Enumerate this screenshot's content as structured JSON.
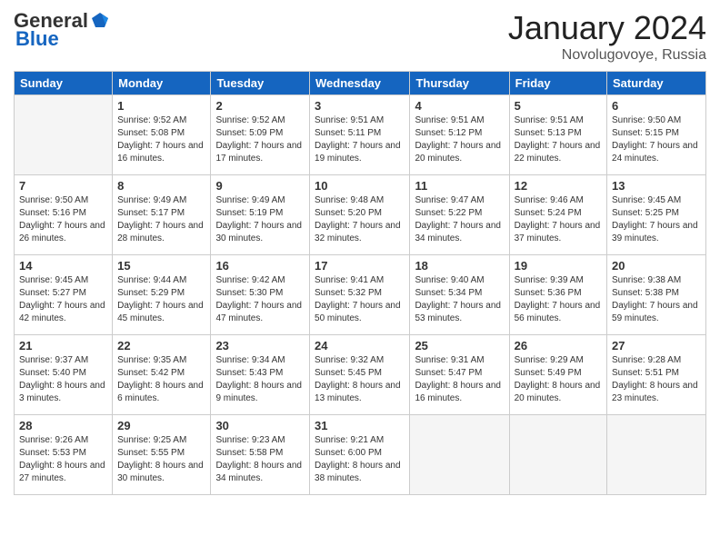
{
  "header": {
    "logo_general": "General",
    "logo_blue": "Blue",
    "month": "January 2024",
    "location": "Novolugovoye, Russia"
  },
  "days_of_week": [
    "Sunday",
    "Monday",
    "Tuesday",
    "Wednesday",
    "Thursday",
    "Friday",
    "Saturday"
  ],
  "weeks": [
    [
      {
        "day": "",
        "empty": true
      },
      {
        "day": "1",
        "sunrise": "Sunrise: 9:52 AM",
        "sunset": "Sunset: 5:08 PM",
        "daylight": "Daylight: 7 hours and 16 minutes."
      },
      {
        "day": "2",
        "sunrise": "Sunrise: 9:52 AM",
        "sunset": "Sunset: 5:09 PM",
        "daylight": "Daylight: 7 hours and 17 minutes."
      },
      {
        "day": "3",
        "sunrise": "Sunrise: 9:51 AM",
        "sunset": "Sunset: 5:11 PM",
        "daylight": "Daylight: 7 hours and 19 minutes."
      },
      {
        "day": "4",
        "sunrise": "Sunrise: 9:51 AM",
        "sunset": "Sunset: 5:12 PM",
        "daylight": "Daylight: 7 hours and 20 minutes."
      },
      {
        "day": "5",
        "sunrise": "Sunrise: 9:51 AM",
        "sunset": "Sunset: 5:13 PM",
        "daylight": "Daylight: 7 hours and 22 minutes."
      },
      {
        "day": "6",
        "sunrise": "Sunrise: 9:50 AM",
        "sunset": "Sunset: 5:15 PM",
        "daylight": "Daylight: 7 hours and 24 minutes."
      }
    ],
    [
      {
        "day": "7",
        "sunrise": "Sunrise: 9:50 AM",
        "sunset": "Sunset: 5:16 PM",
        "daylight": "Daylight: 7 hours and 26 minutes."
      },
      {
        "day": "8",
        "sunrise": "Sunrise: 9:49 AM",
        "sunset": "Sunset: 5:17 PM",
        "daylight": "Daylight: 7 hours and 28 minutes."
      },
      {
        "day": "9",
        "sunrise": "Sunrise: 9:49 AM",
        "sunset": "Sunset: 5:19 PM",
        "daylight": "Daylight: 7 hours and 30 minutes."
      },
      {
        "day": "10",
        "sunrise": "Sunrise: 9:48 AM",
        "sunset": "Sunset: 5:20 PM",
        "daylight": "Daylight: 7 hours and 32 minutes."
      },
      {
        "day": "11",
        "sunrise": "Sunrise: 9:47 AM",
        "sunset": "Sunset: 5:22 PM",
        "daylight": "Daylight: 7 hours and 34 minutes."
      },
      {
        "day": "12",
        "sunrise": "Sunrise: 9:46 AM",
        "sunset": "Sunset: 5:24 PM",
        "daylight": "Daylight: 7 hours and 37 minutes."
      },
      {
        "day": "13",
        "sunrise": "Sunrise: 9:45 AM",
        "sunset": "Sunset: 5:25 PM",
        "daylight": "Daylight: 7 hours and 39 minutes."
      }
    ],
    [
      {
        "day": "14",
        "sunrise": "Sunrise: 9:45 AM",
        "sunset": "Sunset: 5:27 PM",
        "daylight": "Daylight: 7 hours and 42 minutes."
      },
      {
        "day": "15",
        "sunrise": "Sunrise: 9:44 AM",
        "sunset": "Sunset: 5:29 PM",
        "daylight": "Daylight: 7 hours and 45 minutes."
      },
      {
        "day": "16",
        "sunrise": "Sunrise: 9:42 AM",
        "sunset": "Sunset: 5:30 PM",
        "daylight": "Daylight: 7 hours and 47 minutes."
      },
      {
        "day": "17",
        "sunrise": "Sunrise: 9:41 AM",
        "sunset": "Sunset: 5:32 PM",
        "daylight": "Daylight: 7 hours and 50 minutes."
      },
      {
        "day": "18",
        "sunrise": "Sunrise: 9:40 AM",
        "sunset": "Sunset: 5:34 PM",
        "daylight": "Daylight: 7 hours and 53 minutes."
      },
      {
        "day": "19",
        "sunrise": "Sunrise: 9:39 AM",
        "sunset": "Sunset: 5:36 PM",
        "daylight": "Daylight: 7 hours and 56 minutes."
      },
      {
        "day": "20",
        "sunrise": "Sunrise: 9:38 AM",
        "sunset": "Sunset: 5:38 PM",
        "daylight": "Daylight: 7 hours and 59 minutes."
      }
    ],
    [
      {
        "day": "21",
        "sunrise": "Sunrise: 9:37 AM",
        "sunset": "Sunset: 5:40 PM",
        "daylight": "Daylight: 8 hours and 3 minutes."
      },
      {
        "day": "22",
        "sunrise": "Sunrise: 9:35 AM",
        "sunset": "Sunset: 5:42 PM",
        "daylight": "Daylight: 8 hours and 6 minutes."
      },
      {
        "day": "23",
        "sunrise": "Sunrise: 9:34 AM",
        "sunset": "Sunset: 5:43 PM",
        "daylight": "Daylight: 8 hours and 9 minutes."
      },
      {
        "day": "24",
        "sunrise": "Sunrise: 9:32 AM",
        "sunset": "Sunset: 5:45 PM",
        "daylight": "Daylight: 8 hours and 13 minutes."
      },
      {
        "day": "25",
        "sunrise": "Sunrise: 9:31 AM",
        "sunset": "Sunset: 5:47 PM",
        "daylight": "Daylight: 8 hours and 16 minutes."
      },
      {
        "day": "26",
        "sunrise": "Sunrise: 9:29 AM",
        "sunset": "Sunset: 5:49 PM",
        "daylight": "Daylight: 8 hours and 20 minutes."
      },
      {
        "day": "27",
        "sunrise": "Sunrise: 9:28 AM",
        "sunset": "Sunset: 5:51 PM",
        "daylight": "Daylight: 8 hours and 23 minutes."
      }
    ],
    [
      {
        "day": "28",
        "sunrise": "Sunrise: 9:26 AM",
        "sunset": "Sunset: 5:53 PM",
        "daylight": "Daylight: 8 hours and 27 minutes."
      },
      {
        "day": "29",
        "sunrise": "Sunrise: 9:25 AM",
        "sunset": "Sunset: 5:55 PM",
        "daylight": "Daylight: 8 hours and 30 minutes."
      },
      {
        "day": "30",
        "sunrise": "Sunrise: 9:23 AM",
        "sunset": "Sunset: 5:58 PM",
        "daylight": "Daylight: 8 hours and 34 minutes."
      },
      {
        "day": "31",
        "sunrise": "Sunrise: 9:21 AM",
        "sunset": "Sunset: 6:00 PM",
        "daylight": "Daylight: 8 hours and 38 minutes."
      },
      {
        "day": "",
        "empty": true
      },
      {
        "day": "",
        "empty": true
      },
      {
        "day": "",
        "empty": true
      }
    ]
  ]
}
